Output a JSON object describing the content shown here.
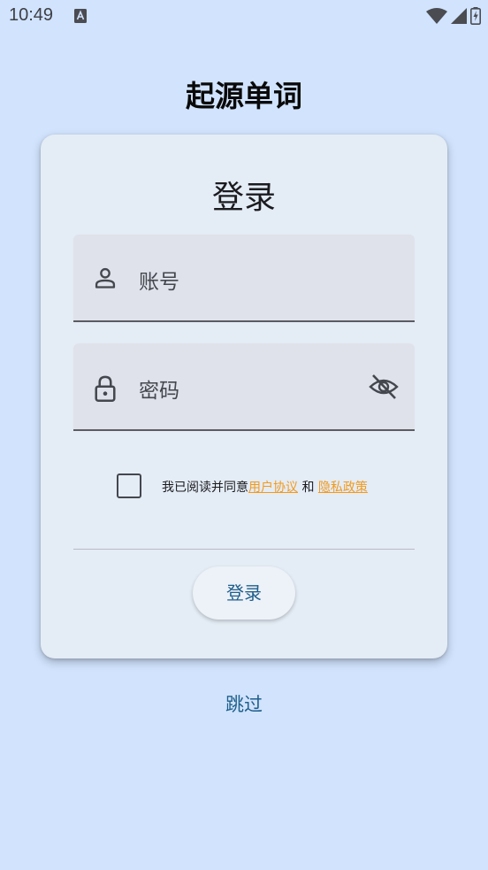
{
  "status_bar": {
    "time": "10:49",
    "icons": [
      "notification-a-icon",
      "wifi-icon",
      "signal-icon",
      "battery-charging-icon"
    ]
  },
  "app": {
    "title": "起源单词"
  },
  "login_card": {
    "title": "登录",
    "account_field": {
      "placeholder": "账号",
      "icon": "person-icon"
    },
    "password_field": {
      "placeholder": "密码",
      "icon": "lock-icon",
      "toggle_icon": "eye-off-icon"
    },
    "agreement": {
      "checked": false,
      "prefix": "我已阅读并同意",
      "user_agreement": "用户协议",
      "conjunction": " 和 ",
      "privacy_policy": "隐私政策"
    },
    "login_button": "登录"
  },
  "skip_label": "跳过",
  "colors": {
    "background": "#d1e3fd",
    "card": "#e4ecf5",
    "field": "#dfe2ea",
    "accent": "#1f5f8b",
    "link": "#f29a1d"
  }
}
